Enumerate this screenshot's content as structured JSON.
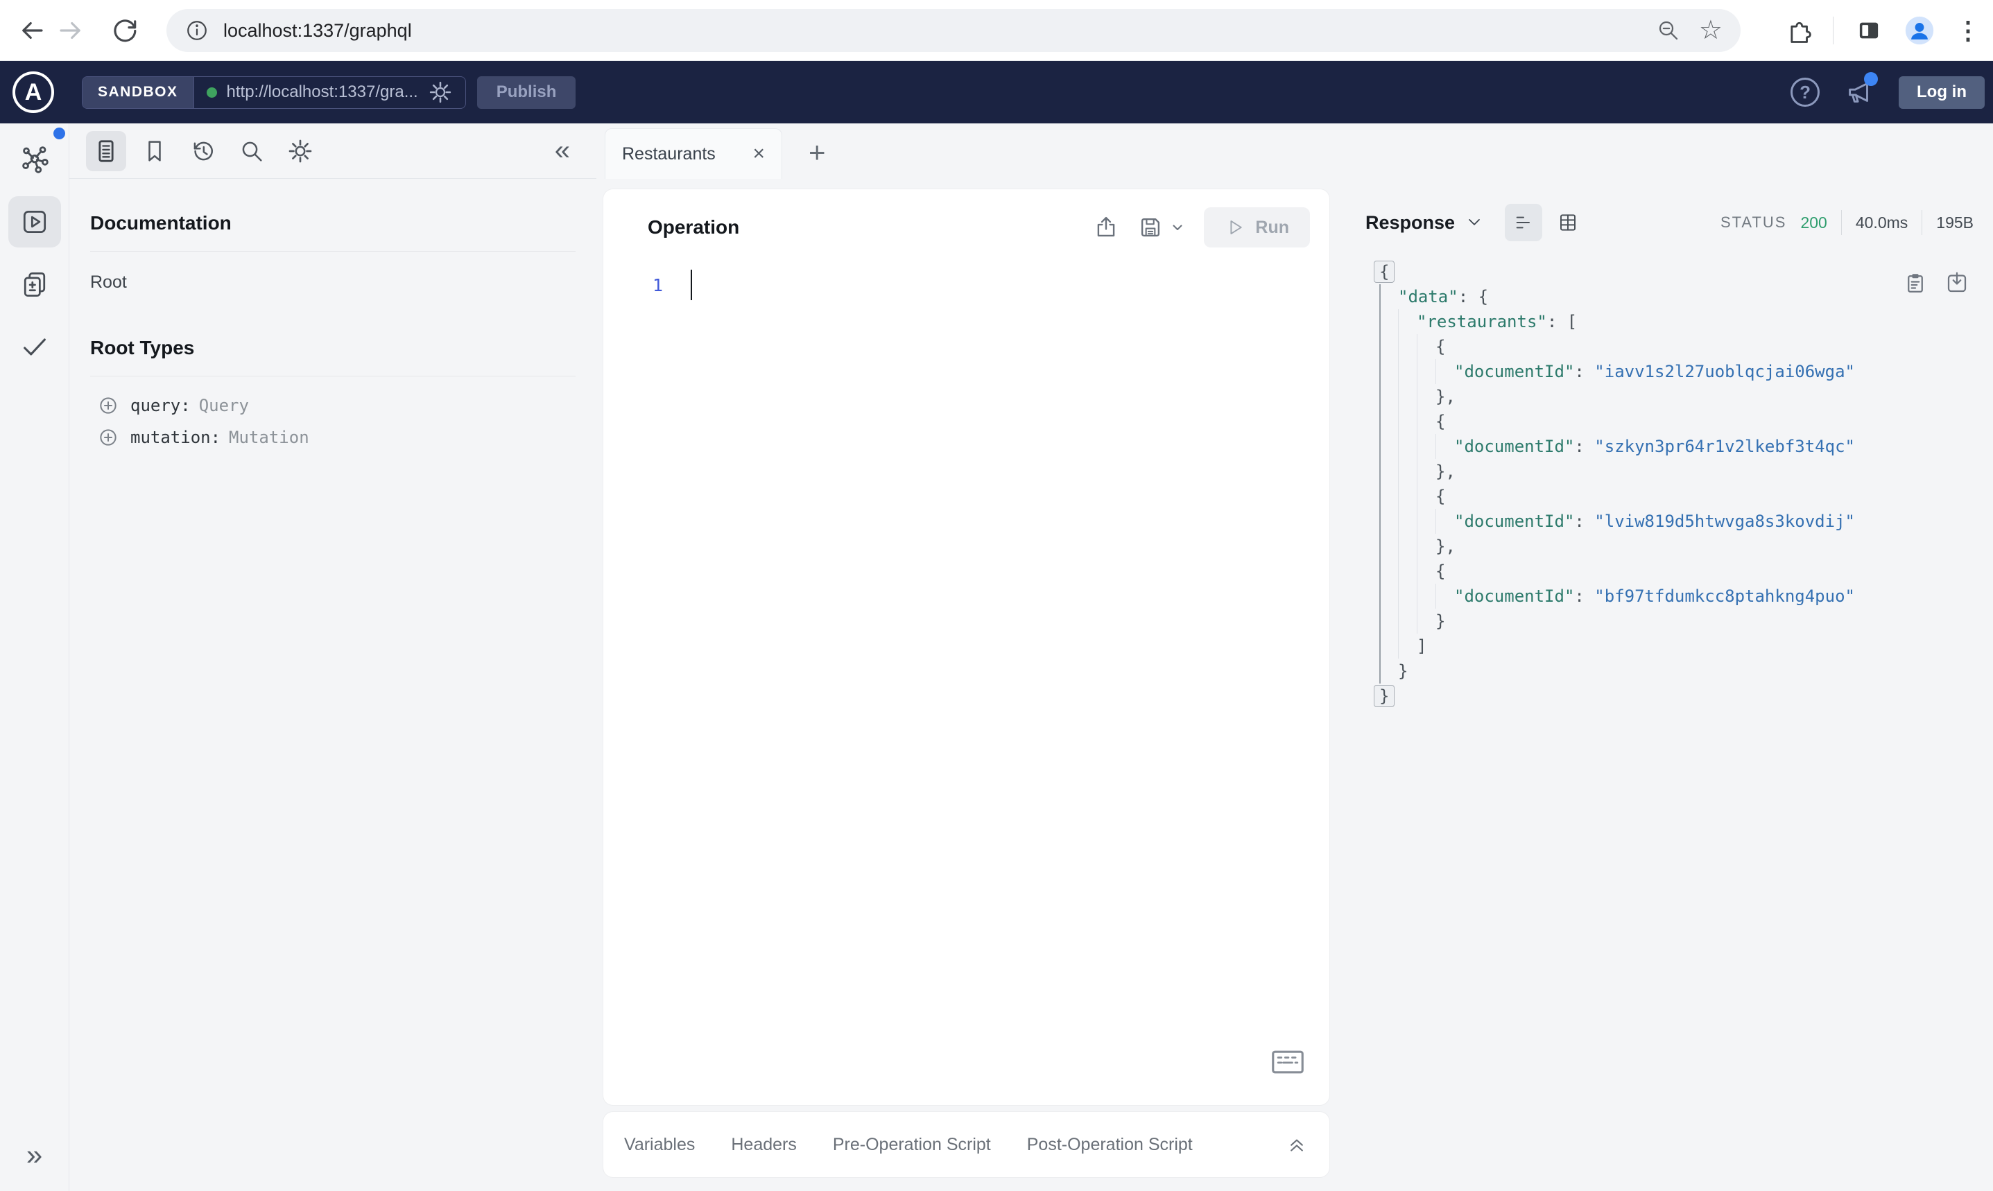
{
  "browser": {
    "url": "localhost:1337/graphql"
  },
  "sandbox_header": {
    "env_label": "SANDBOX",
    "endpoint_url": "http://localhost:1337/gra...",
    "publish_label": "Publish",
    "login_label": "Log in"
  },
  "docs_panel": {
    "title": "Documentation",
    "root_link": "Root",
    "root_types_title": "Root Types",
    "root_types": [
      {
        "field": "query:",
        "type": "Query"
      },
      {
        "field": "mutation:",
        "type": "Mutation"
      }
    ]
  },
  "operation_panel": {
    "tab_title": "Restaurants",
    "title": "Operation",
    "run_label": "Run",
    "line_number": "1",
    "footer_tabs": [
      "Variables",
      "Headers",
      "Pre-Operation Script",
      "Post-Operation Script"
    ]
  },
  "response_panel": {
    "title": "Response",
    "status_label": "STATUS",
    "status_code": "200",
    "duration": "40.0ms",
    "size": "195B",
    "json_lines": [
      {
        "indent": 0,
        "fold": true,
        "tokens": [
          [
            "p",
            "{"
          ]
        ]
      },
      {
        "indent": 1,
        "tokens": [
          [
            "k",
            "\"data\""
          ],
          [
            "p",
            ": {"
          ]
        ]
      },
      {
        "indent": 2,
        "tokens": [
          [
            "k",
            "\"restaurants\""
          ],
          [
            "p",
            ": ["
          ]
        ]
      },
      {
        "indent": 3,
        "tokens": [
          [
            "p",
            "{"
          ]
        ]
      },
      {
        "indent": 4,
        "tokens": [
          [
            "k",
            "\"documentId\""
          ],
          [
            "p",
            ": "
          ],
          [
            "s",
            "\"iavv1s2l27uoblqcjai06wga\""
          ]
        ]
      },
      {
        "indent": 3,
        "tokens": [
          [
            "p",
            "},"
          ]
        ]
      },
      {
        "indent": 3,
        "tokens": [
          [
            "p",
            "{"
          ]
        ]
      },
      {
        "indent": 4,
        "tokens": [
          [
            "k",
            "\"documentId\""
          ],
          [
            "p",
            ": "
          ],
          [
            "s",
            "\"szkyn3pr64r1v2lkebf3t4qc\""
          ]
        ]
      },
      {
        "indent": 3,
        "tokens": [
          [
            "p",
            "},"
          ]
        ]
      },
      {
        "indent": 3,
        "tokens": [
          [
            "p",
            "{"
          ]
        ]
      },
      {
        "indent": 4,
        "tokens": [
          [
            "k",
            "\"documentId\""
          ],
          [
            "p",
            ": "
          ],
          [
            "s",
            "\"lviw819d5htwvga8s3kovdij\""
          ]
        ]
      },
      {
        "indent": 3,
        "tokens": [
          [
            "p",
            "},"
          ]
        ]
      },
      {
        "indent": 3,
        "tokens": [
          [
            "p",
            "{"
          ]
        ]
      },
      {
        "indent": 4,
        "tokens": [
          [
            "k",
            "\"documentId\""
          ],
          [
            "p",
            ": "
          ],
          [
            "s",
            "\"bf97tfdumkcc8ptahkng4puo\""
          ]
        ]
      },
      {
        "indent": 3,
        "tokens": [
          [
            "p",
            "}"
          ]
        ]
      },
      {
        "indent": 2,
        "tokens": [
          [
            "p",
            "]"
          ]
        ]
      },
      {
        "indent": 1,
        "tokens": [
          [
            "p",
            "}"
          ]
        ]
      },
      {
        "indent": 0,
        "fold": true,
        "tokens": [
          [
            "p",
            "}"
          ]
        ]
      }
    ]
  },
  "icons": {
    "collapse_left": "«",
    "expand_right": "»",
    "star": "☆",
    "overflow_menu": "⋮",
    "new_tab": "+",
    "close_tab": "×",
    "help": "?",
    "logo_letter": "A"
  },
  "colors": {
    "header_bg": "#1B2342",
    "status_green": "#2F9E6E",
    "endpoint_dot_green": "#3FA35F",
    "json_key": "#2C7A6B",
    "json_string": "#3470B2",
    "json_punct": "#4A5259",
    "notification_blue": "#3D85F4",
    "accent_blue": "#2E72E8",
    "editor_line_number": "#4059D9"
  }
}
